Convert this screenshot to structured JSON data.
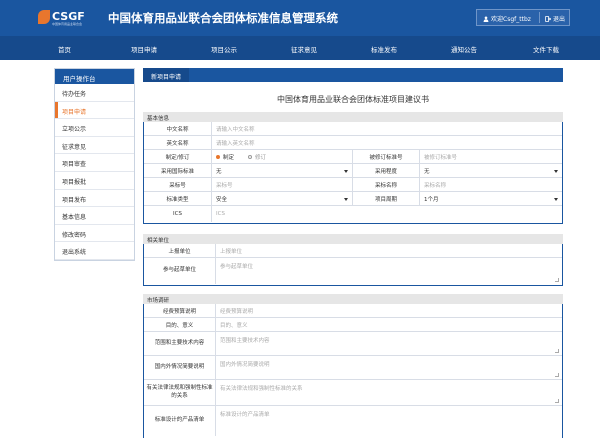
{
  "header": {
    "logo_text": "CSGF",
    "logo_sub": "中国体育用品业联合会",
    "site_title": "中国体育用品业联合会团体标准信息管理系统",
    "user_label": "欢迎Csgf_ttbz",
    "logout_label": "退出"
  },
  "nav": [
    "首页",
    "项目申请",
    "项目公示",
    "征求意见",
    "标准发布",
    "通知公告",
    "文件下载"
  ],
  "sidebar": {
    "title": "用户操作台",
    "items": [
      "待办任务",
      "项目申请",
      "立项公示",
      "征求意见",
      "项目审查",
      "项目报批",
      "项目发布",
      "基本信息",
      "修改密码",
      "退出系统"
    ],
    "active_index": 1
  },
  "tab_label": "新项目申请",
  "form_title": "中国体育用品业联合会团体标准项目建议书",
  "basic": {
    "section_title": "基本信息",
    "cn_name_label": "中文名称",
    "cn_name_ph": "请输入中文名称",
    "en_name_label": "英文名称",
    "en_name_ph": "请输入英文名称",
    "rev_label": "制定/修订",
    "rev_opt1": "制定",
    "rev_opt2": "修订",
    "revised_std_label": "被修订标准号",
    "revised_std_ph": "被修订标准号",
    "intl_label": "采用国际标准",
    "intl_value": "无",
    "degree_label": "采用程度",
    "degree_value": "无",
    "adopt_no_label": "采标号",
    "adopt_no_ph": "采标号",
    "adopt_name_label": "采标名称",
    "adopt_name_ph": "采标名称",
    "std_type_label": "标准类型",
    "std_type_value": "安全",
    "cycle_label": "项目周期",
    "cycle_value": "1个月",
    "ics_label": "ICS",
    "ics_ph": "ICS"
  },
  "units": {
    "section_title": "相关单位",
    "submit_label": "上报单位",
    "submit_ph": "上报单位",
    "draft_label": "参与起草单位",
    "draft_ph": "参与起草单位"
  },
  "market": {
    "section_title": "市场调研",
    "budget_label": "经费预算说明",
    "budget_ph": "经费预算说明",
    "purpose_label": "目的、意义",
    "purpose_ph": "目的、意义",
    "scope_label": "范围和主要技术内容",
    "scope_ph": "范围和主要技术内容",
    "status_label": "国内外情况简要说明",
    "status_ph": "国内外情况简要说明",
    "laws_label": "有关法律法规和强制性标准的关系",
    "laws_ph": "有关法律法规和强制性标准的关系",
    "product_label": "标准设计的产品清单",
    "product_ph": "标准设计的产品清单"
  },
  "colors": {
    "primary": "#1a56a0",
    "nav": "#164a8c",
    "accent": "#e8762d"
  }
}
